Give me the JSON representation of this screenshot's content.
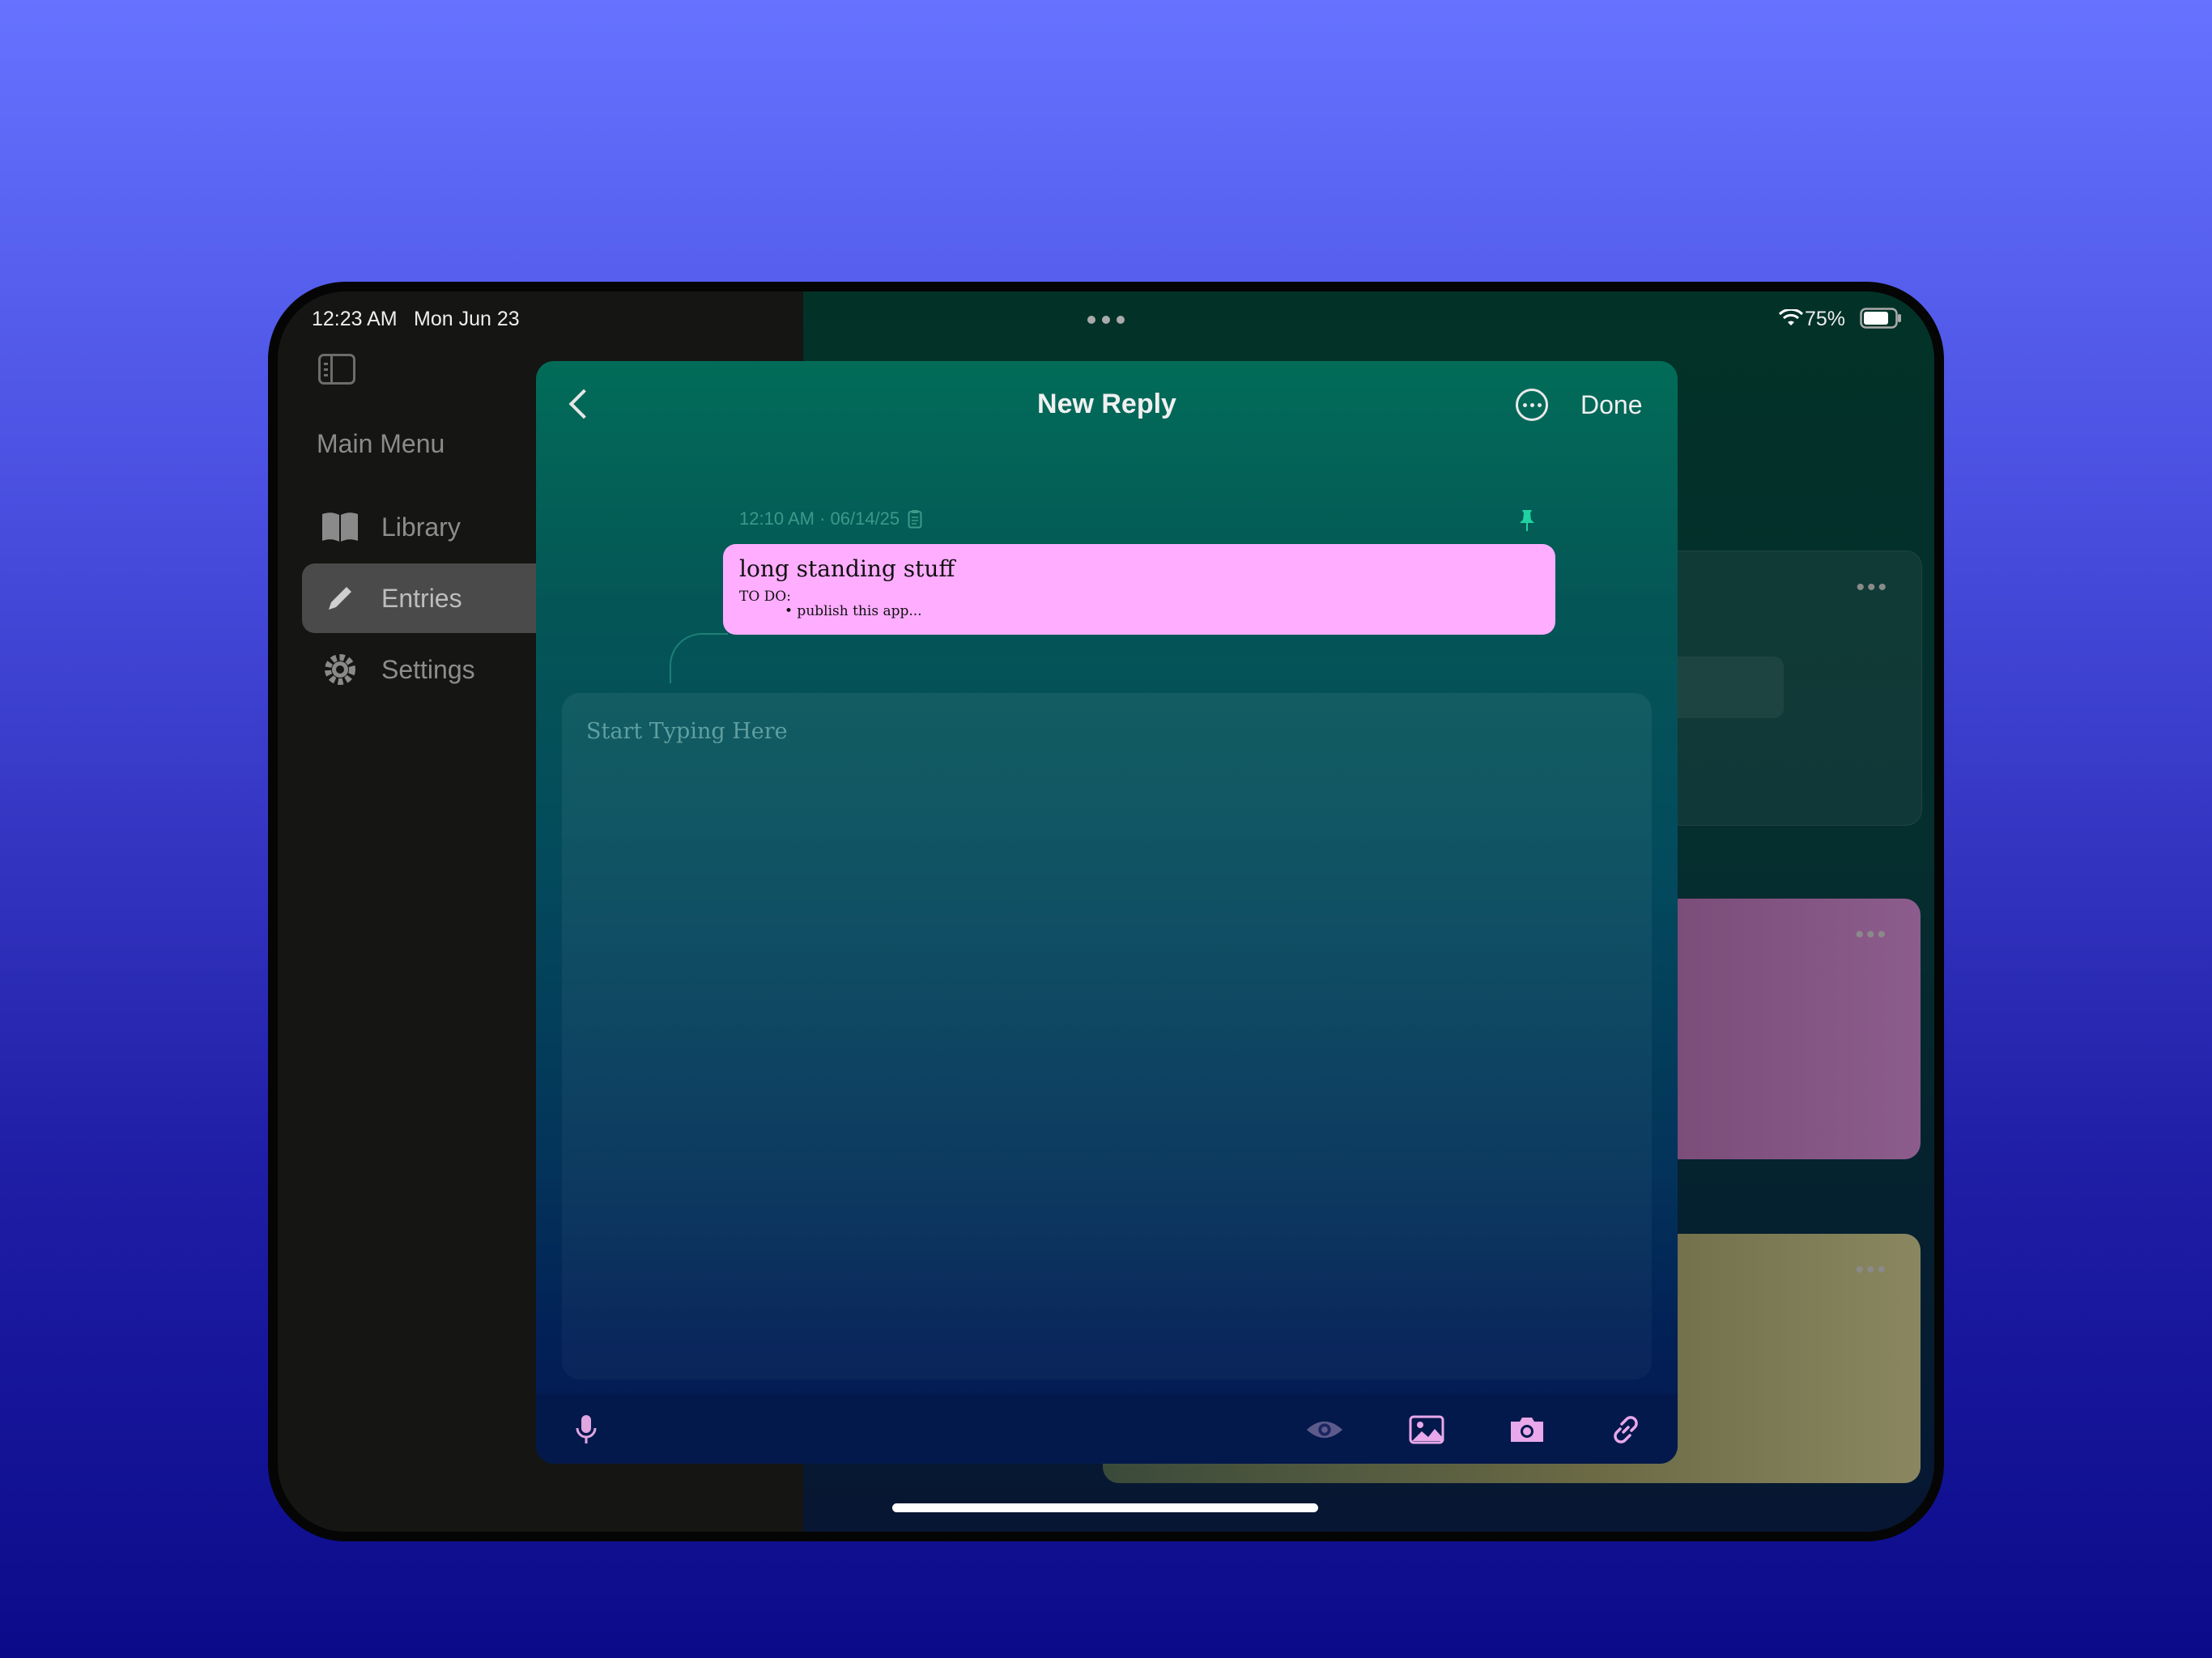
{
  "status_bar": {
    "time": "12:23 AM",
    "date": "Mon Jun 23",
    "battery": "75%"
  },
  "sidebar": {
    "heading": "Main Menu",
    "items": [
      {
        "label": "Library",
        "icon": "book-icon"
      },
      {
        "label": "Entries",
        "icon": "pencil-icon",
        "active": true
      },
      {
        "label": "Settings",
        "icon": "gear-icon"
      }
    ]
  },
  "modal": {
    "title": "New Reply",
    "done_label": "Done",
    "entry": {
      "meta": "12:10 AM · 06/14/25",
      "title": "long standing stuff",
      "subtitle": "TO DO:",
      "bullet": "• publish this app..."
    },
    "editor_placeholder": "Start Typing Here",
    "toolbar": [
      "microphone-icon",
      "eye-icon",
      "image-icon",
      "camera-icon",
      "link-icon"
    ]
  },
  "colors": {
    "accent_pink": "#ffadff",
    "modal_top": "#026c58",
    "modal_bottom": "#041a4e",
    "pin_green": "#1fd3a0"
  }
}
